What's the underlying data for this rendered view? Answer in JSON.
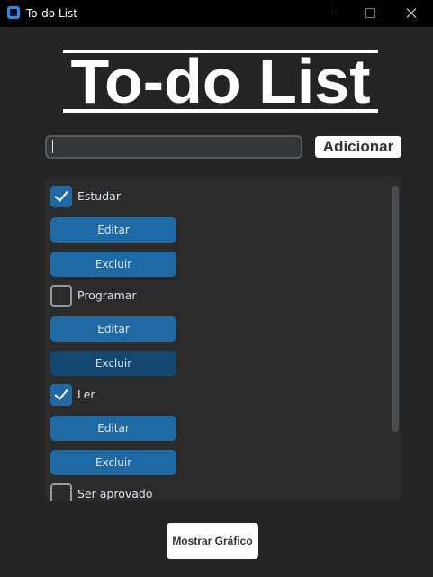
{
  "window": {
    "title": "To-do List",
    "icon": "app-icon",
    "controls": [
      "minimize-icon",
      "maximize-icon",
      "close-icon"
    ]
  },
  "header": {
    "title": "To-do List"
  },
  "input": {
    "value": "",
    "placeholder": ""
  },
  "add_button": {
    "label": "Adicionar"
  },
  "tasks": [
    {
      "label": "Estudar",
      "checked": true,
      "edit_label": "Editar",
      "delete_label": "Excluir"
    },
    {
      "label": "Programar",
      "checked": false,
      "edit_label": "Editar",
      "delete_label": "Excluir"
    },
    {
      "label": "Ler",
      "checked": true,
      "edit_label": "Editar",
      "delete_label": "Excluir"
    },
    {
      "label": "Ser aprovado",
      "checked": false
    }
  ],
  "chart_button": {
    "label": "Mostrar Gráfico"
  },
  "colors": {
    "background": "#242424",
    "frame": "#2b2b2b",
    "accent": "#1f6aa5",
    "accent_hover": "#144870",
    "text": "#dce4ee"
  }
}
